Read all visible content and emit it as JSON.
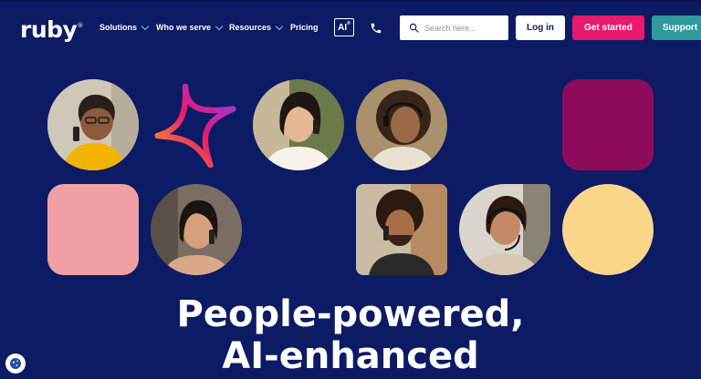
{
  "brand": {
    "name": "ruby",
    "mark": "®"
  },
  "nav": [
    {
      "label": "Solutions",
      "dropdown": true
    },
    {
      "label": "Who we serve",
      "dropdown": true
    },
    {
      "label": "Resources",
      "dropdown": true
    },
    {
      "label": "Pricing",
      "dropdown": false
    }
  ],
  "ai_badge": {
    "label": "AI",
    "mark": "®"
  },
  "search": {
    "placeholder": "Search here..."
  },
  "buttons": {
    "login": "Log in",
    "get_started": "Get started",
    "support": "Support"
  },
  "hero": {
    "line1": "People-powered,",
    "line2": "AI-enhanced"
  },
  "colors": {
    "background": "#0c1b64",
    "accent_pink": "#e8196e",
    "accent_teal": "#2e9a9e",
    "tile_magenta": "#8e0a5c",
    "tile_rose": "#f0a0a4",
    "tile_butter": "#f9d68a"
  },
  "icons": [
    "phone-icon",
    "search-icon",
    "chevron-down-icon",
    "sparkle-star-icon",
    "cookie-icon"
  ]
}
